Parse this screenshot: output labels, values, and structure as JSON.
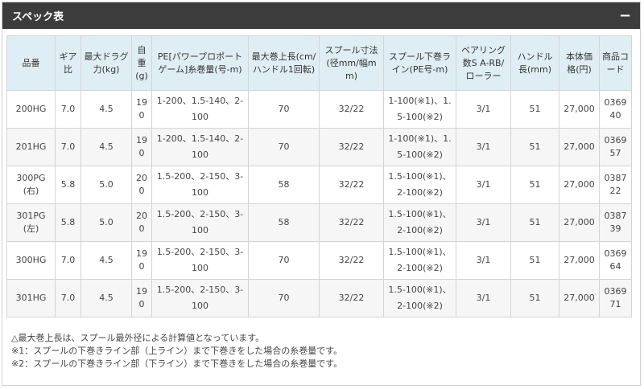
{
  "header": {
    "title": "スペック表",
    "collapse_label": "−"
  },
  "table": {
    "columns": [
      "品番",
      "ギア比",
      "最大ドラグ力(kg)",
      "自重(g)",
      "PE[パワープロポートゲーム]糸巻量(号-m)",
      "最大巻上長(cm/ハンドル1回転)",
      "スプール寸法(径mm/幅mm)",
      "スプール下巻ライン(PE号-m)",
      "ベアリング数S A-RB/ローラー",
      "ハンドル長(mm)",
      "本体価格(円)",
      "商品コード"
    ],
    "rows": [
      [
        "200HG",
        "7.0",
        "4.5",
        "190",
        "1-200、1.5-140、2-100",
        "70",
        "32/22",
        "1-100(※1)、1.5-100(※2)",
        "3/1",
        "51",
        "27,000",
        "036940"
      ],
      [
        "201HG",
        "7.0",
        "4.5",
        "190",
        "1-200、1.5-140、2-100",
        "70",
        "32/22",
        "1-100(※1)、1.5-100(※2)",
        "3/1",
        "51",
        "27,000",
        "036957"
      ],
      [
        "300PG(右)",
        "5.8",
        "5.0",
        "200",
        "1.5-200、2-150、3-100",
        "58",
        "32/22",
        "1.5-100(※1)、2-100(※2)",
        "3/1",
        "51",
        "27,000",
        "038722"
      ],
      [
        "301PG(左)",
        "5.8",
        "5.0",
        "200",
        "1.5-200、2-150、3-100",
        "58",
        "32/22",
        "1.5-100(※1)、2-100(※2)",
        "3/1",
        "51",
        "27,000",
        "038739"
      ],
      [
        "300HG",
        "7.0",
        "4.5",
        "190",
        "1.5-200、2-150、3-100",
        "70",
        "32/22",
        "1.5-100(※1)、2-100(※2)",
        "3/1",
        "51",
        "27,000",
        "036964"
      ],
      [
        "301HG",
        "7.0",
        "4.5",
        "190",
        "1.5-200、2-150、3-100",
        "70",
        "32/22",
        "1.5-100(※1)、2-100(※2)",
        "3/1",
        "51",
        "27,000",
        "036971"
      ]
    ]
  },
  "notes": [
    "△最大巻上長は、スプール最外径による計算値となっています。",
    "※1：スプールの下巻きライン部（上ライン）まで下巻きをした場合の糸巻量です。",
    "※2：スプールの下巻きライン部（下ライン）まで下巻きをした場合の糸巻量です。"
  ],
  "colors": {
    "header_bg": "#3c3c3c",
    "table_header_bg": "#dfeef5",
    "border": "#d4d4d4"
  }
}
